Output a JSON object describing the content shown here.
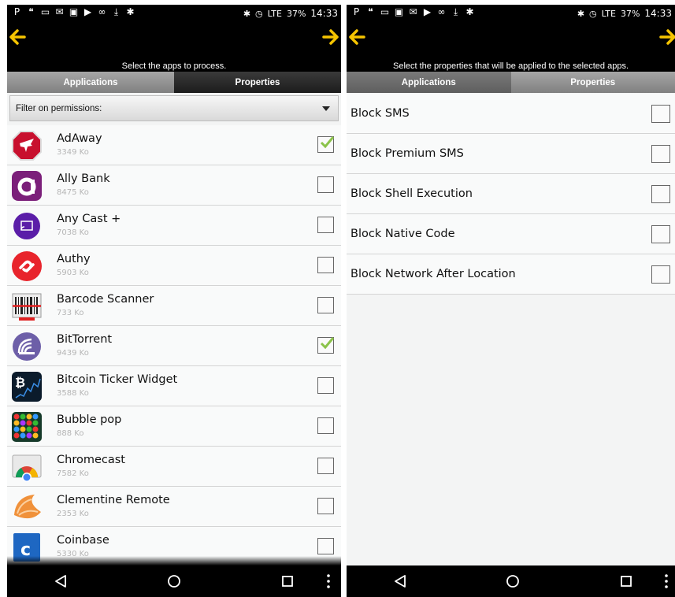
{
  "status": {
    "battery": "37%",
    "time": "14:33",
    "lte": "LTE"
  },
  "colors": {
    "accent": "#f5c400",
    "check": "#8bc34a"
  },
  "left": {
    "header_text": "Select the apps to process.",
    "tabs": [
      {
        "label": "Applications",
        "active": true
      },
      {
        "label": "Properties",
        "active": false
      }
    ],
    "filter_label": "Filter on permissions:",
    "apps": [
      {
        "name": "AdAway",
        "size": "3349 Ko",
        "checked": true,
        "icon": "adaway-icon"
      },
      {
        "name": "Ally Bank",
        "size": "8475 Ko",
        "checked": false,
        "icon": "ally-bank-icon"
      },
      {
        "name": "Any Cast +",
        "size": "7038 Ko",
        "checked": false,
        "icon": "anycast-icon"
      },
      {
        "name": "Authy",
        "size": "5903 Ko",
        "checked": false,
        "icon": "authy-icon"
      },
      {
        "name": "Barcode Scanner",
        "size": "733 Ko",
        "checked": false,
        "icon": "barcode-icon"
      },
      {
        "name": "BitTorrent",
        "size": "9439 Ko",
        "checked": true,
        "icon": "bittorrent-icon"
      },
      {
        "name": "Bitcoin Ticker Widget",
        "size": "3588 Ko",
        "checked": false,
        "icon": "bitcoin-icon"
      },
      {
        "name": "Bubble pop",
        "size": "888 Ko",
        "checked": false,
        "icon": "bubble-pop-icon"
      },
      {
        "name": "Chromecast",
        "size": "7582 Ko",
        "checked": false,
        "icon": "chromecast-icon"
      },
      {
        "name": "Clementine Remote",
        "size": "2353 Ko",
        "checked": false,
        "icon": "clementine-icon"
      },
      {
        "name": "Coinbase",
        "size": "5330 Ko",
        "checked": false,
        "icon": "coinbase-icon"
      }
    ]
  },
  "right": {
    "header_text": "Select the properties that will be applied to the selected apps.",
    "tabs": [
      {
        "label": "Applications",
        "active": false
      },
      {
        "label": "Properties",
        "active": true
      }
    ],
    "properties": [
      {
        "label": "Block SMS",
        "checked": false
      },
      {
        "label": "Block Premium SMS",
        "checked": false
      },
      {
        "label": "Block Shell Execution",
        "checked": false
      },
      {
        "label": "Block Native Code",
        "checked": false
      },
      {
        "label": "Block Network After Location",
        "checked": false
      }
    ]
  }
}
